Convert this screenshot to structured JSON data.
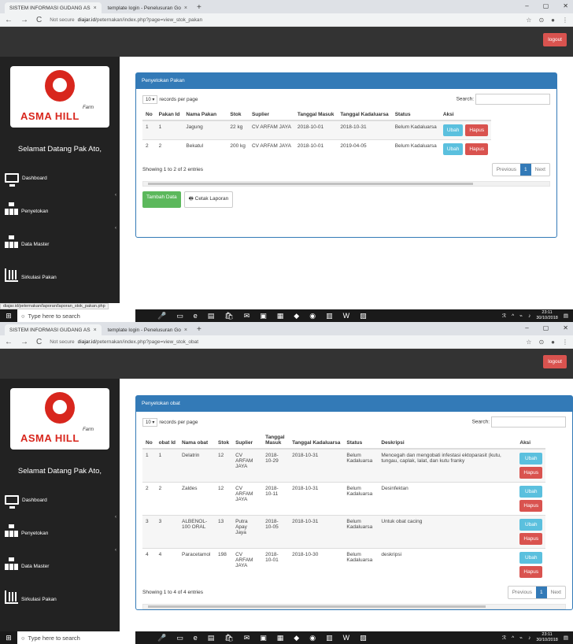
{
  "screens": [
    {
      "tabs": [
        {
          "title": "SISTEM INFORMASI GUDANG AS"
        },
        {
          "title": "template login - Penelusuran Go"
        }
      ],
      "url_prefix": "Not secure",
      "url_domain": "diajar.id",
      "url_path": "/peternakan/index.php?page=view_stok_pakan",
      "logout": "logout",
      "logo_farm": "Farm",
      "logo_name": "ASMA HILL",
      "welcome": "Selamat Datang Pak Ato,",
      "menu": [
        "Dashboard",
        "Penyetokan",
        "Data Master",
        "Sirkulasi Pakan"
      ],
      "panel_title": "Penyetokan Pakan",
      "length_value": "10",
      "records_label": "records per page",
      "search_label": "Search:",
      "columns": [
        "No",
        "Pakan Id",
        "Nama Pakan",
        "Stok",
        "Suplier",
        "Tanggal Masuk",
        "Tanggal Kadaluarsa",
        "Status",
        "Aksi"
      ],
      "rows": [
        [
          "1",
          "1",
          "Jagung",
          "22 kg",
          "CV ARFAM JAYA",
          "2018-10-01",
          "2018-10-31",
          "Belum Kadaluarsa"
        ],
        [
          "2",
          "2",
          "Bekatul",
          "200 kg",
          "CV ARFAM JAYA",
          "2018-10-01",
          "2019-04-05",
          "Belum Kadaluarsa"
        ]
      ],
      "btn_edit": "Ubah",
      "btn_delete": "Hapus",
      "info": "Showing 1 to 2 of 2 entries",
      "pager": [
        "Previous",
        "1",
        "Next"
      ],
      "btn_add": "Tambah Data",
      "btn_print": "Cetak Laporan",
      "status_url": "diajar.id/peternakan/laporan/laporan_stok_pakan.php",
      "taskbar_search": "Type here to search",
      "time": "23:11",
      "date": "30/10/2018"
    },
    {
      "tabs": [
        {
          "title": "SISTEM INFORMASI GUDANG AS"
        },
        {
          "title": "template login - Penelusuran Go"
        }
      ],
      "url_prefix": "Not secure",
      "url_domain": "diajar.id",
      "url_path": "/peternakan/index.php?page=view_stok_obat",
      "logout": "logout",
      "logo_farm": "Farm",
      "logo_name": "ASMA HILL",
      "welcome": "Selamat Datang Pak Ato,",
      "menu": [
        "Dashboard",
        "Penyetokan",
        "Data Master",
        "Sirkulasi Pakan"
      ],
      "panel_title": "Penyetokan obat",
      "length_value": "10",
      "records_label": "records per page",
      "search_label": "Search:",
      "columns": [
        "No",
        "obat Id",
        "Nama obat",
        "Stok",
        "Suplier",
        "Tanggal Masuk",
        "Tanggal Kadaluarsa",
        "Status",
        "Deskripsi",
        "Aksi"
      ],
      "rows": [
        [
          "1",
          "1",
          "Delatrin",
          "12",
          "CV ARFAM JAYA",
          "2018-10-29",
          "2018-10-31",
          "Belum Kadaluarsa",
          "Mencegah dan mengobati infestasi ektoparasit (kutu, tungau, caplak, lalat, dan kutu franky"
        ],
        [
          "2",
          "2",
          "Zaldes",
          "12",
          "CV ARFAM JAYA",
          "2018-10-11",
          "2018-10-31",
          "Belum Kadaluarsa",
          "Desinfektan"
        ],
        [
          "3",
          "3",
          "ALBENOL-100 ORAL",
          "13",
          "Putra Apay Jaya",
          "2018-10-05",
          "2018-10-31",
          "Belum Kadaluarsa",
          "Untuk obat cacing"
        ],
        [
          "4",
          "4",
          "Paracetamol",
          "198",
          "CV ARFAM JAYA",
          "2018-10-01",
          "2018-10-30",
          "Belum Kadaluarsa",
          "deskripsi"
        ]
      ],
      "btn_edit": "Ubah",
      "btn_delete": "Hapus",
      "info": "Showing 1 to 4 of 4 entries",
      "pager": [
        "Previous",
        "1",
        "Next"
      ],
      "taskbar_search": "Type here to search",
      "time": "23:11",
      "date": "30/10/2018"
    }
  ],
  "colors": {
    "primary": "#337ab7",
    "danger": "#d9534f",
    "info": "#5bc0de",
    "success": "#5cb85c",
    "sidebar": "#222222",
    "topbar": "#333333"
  }
}
